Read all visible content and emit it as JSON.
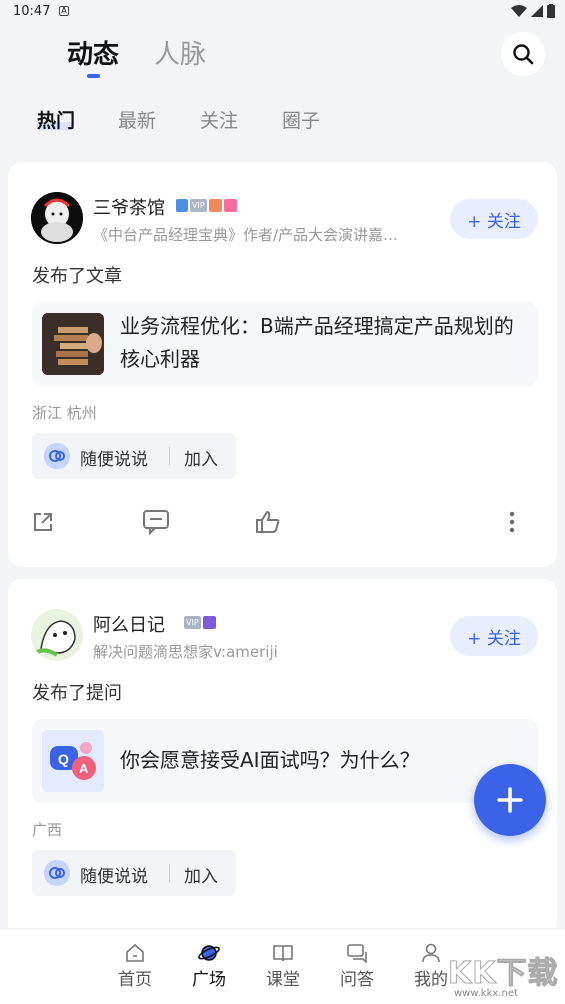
{
  "status_bar": {
    "time": "10:47",
    "notif": "A"
  },
  "header": {
    "tabs": [
      {
        "label": "动态"
      },
      {
        "label": "人脉"
      }
    ],
    "sub_tabs": [
      {
        "label": "热门"
      },
      {
        "label": "最新"
      },
      {
        "label": "关注"
      },
      {
        "label": "圈子"
      }
    ]
  },
  "posts": [
    {
      "author": "三爷茶馆",
      "badge_vip": "VIP",
      "description": "《中台产品经理宝典》作者/产品大会演讲嘉…",
      "follow_label": "+ 关注",
      "action": "发布了文章",
      "title": "业务流程优化：B端产品经理搞定产品规划的核心利器",
      "location": "浙江 杭州",
      "circle": {
        "name": "随便说说",
        "join": "加入"
      }
    },
    {
      "author": "阿么日记",
      "badge_vip": "VIP",
      "description": "解决问题滴思想家v:ameriji",
      "follow_label": "+ 关注",
      "action": "发布了提问",
      "title": "你会愿意接受AI面试吗？为什么？",
      "location": "广西",
      "circle": {
        "name": "随便说说",
        "join": "加入"
      }
    }
  ],
  "bottom_nav": [
    {
      "label": "首页"
    },
    {
      "label": "广场"
    },
    {
      "label": "课堂"
    },
    {
      "label": "问答"
    },
    {
      "label": "我的"
    }
  ],
  "watermark": {
    "brand": "KK下载",
    "url": "www.kkx.net"
  },
  "colors": {
    "accent": "#3b63e8",
    "follow_bg": "#e8edff",
    "page_bg": "#f3f4f6"
  }
}
